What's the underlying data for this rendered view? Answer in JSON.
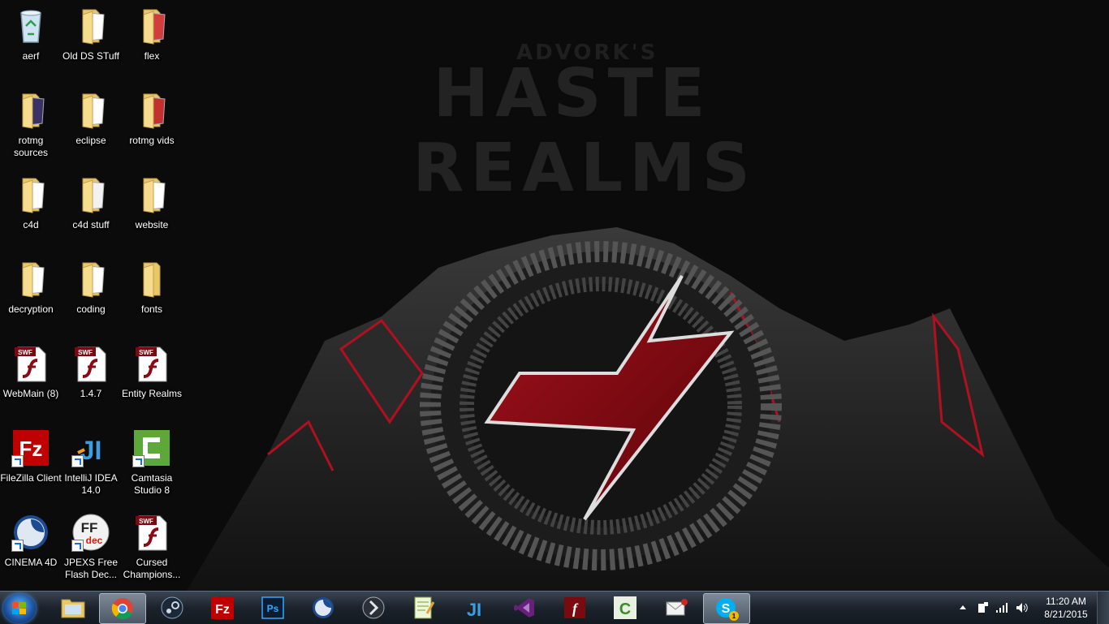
{
  "wallpaper": {
    "subtitle": "ADVORK'S",
    "title_line1": "HASTE",
    "title_line2": "REALMS"
  },
  "desktop": {
    "icons": [
      {
        "label": "aerf",
        "kind": "recycle-bin"
      },
      {
        "label": "Old DS STuff",
        "kind": "folder"
      },
      {
        "label": "flex",
        "kind": "folder"
      },
      {
        "label": "rotmg sources",
        "kind": "folder"
      },
      {
        "label": "eclipse",
        "kind": "folder"
      },
      {
        "label": "rotmg vids",
        "kind": "folder"
      },
      {
        "label": "c4d",
        "kind": "folder"
      },
      {
        "label": "c4d stuff",
        "kind": "folder"
      },
      {
        "label": "website",
        "kind": "folder"
      },
      {
        "label": "decryption",
        "kind": "folder"
      },
      {
        "label": "coding",
        "kind": "folder"
      },
      {
        "label": "fonts",
        "kind": "folder"
      },
      {
        "label": "WebMain (8)",
        "kind": "swf"
      },
      {
        "label": "1.4.7",
        "kind": "swf"
      },
      {
        "label": "Entity Realms",
        "kind": "swf"
      },
      {
        "label": "FileZilla Client",
        "kind": "filezilla"
      },
      {
        "label": "IntelliJ IDEA 14.0",
        "kind": "intellij"
      },
      {
        "label": "Camtasia Studio 8",
        "kind": "camtasia"
      },
      {
        "label": "CINEMA 4D",
        "kind": "cinema4d"
      },
      {
        "label": "JPEXS Free Flash Dec...",
        "kind": "jpexs"
      },
      {
        "label": "Cursed Champions...",
        "kind": "swf"
      }
    ],
    "swf_badge": "SWF"
  },
  "taskbar": {
    "apps": [
      {
        "name": "windows-explorer",
        "text": ""
      },
      {
        "name": "google-chrome",
        "text": ""
      },
      {
        "name": "steam",
        "text": ""
      },
      {
        "name": "filezilla",
        "text": "Fz"
      },
      {
        "name": "photoshop",
        "text": "Ps"
      },
      {
        "name": "cinema-4d",
        "text": ""
      },
      {
        "name": "unknown-app",
        "text": ""
      },
      {
        "name": "notepad-plus-plus",
        "text": ""
      },
      {
        "name": "intellij",
        "text": "JI"
      },
      {
        "name": "visual-studio",
        "text": ""
      },
      {
        "name": "flash",
        "text": "f"
      },
      {
        "name": "camtasia",
        "text": "C"
      },
      {
        "name": "mail",
        "text": ""
      },
      {
        "name": "skype",
        "text": "S"
      }
    ],
    "skype_badge": "1",
    "time": "11:20 AM",
    "date": "8/21/2015"
  },
  "colors": {
    "accent_red": "#8a0b14",
    "taskbar": "#1b222b",
    "folder": "#f4d67a"
  }
}
